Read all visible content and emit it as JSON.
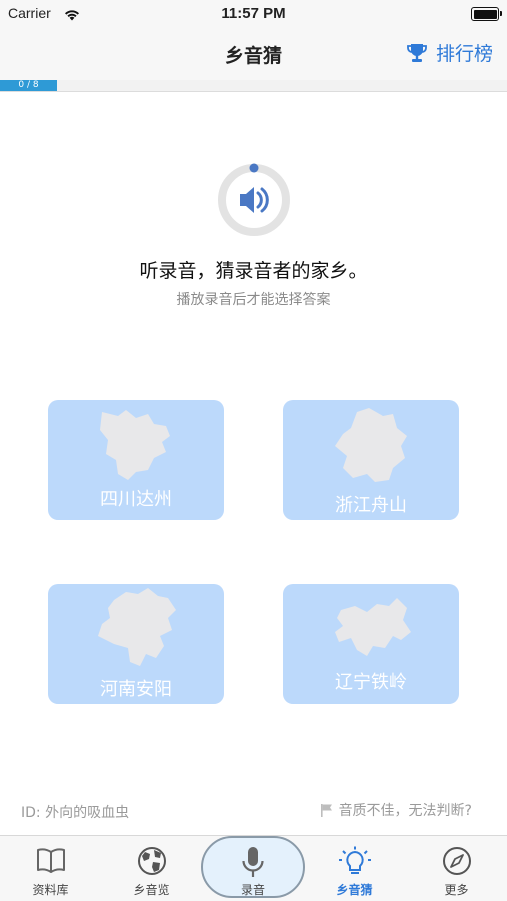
{
  "status": {
    "carrier": "Carrier",
    "time": "11:57 PM"
  },
  "nav": {
    "title": "乡音猜",
    "rank_label": "排行榜"
  },
  "progress": {
    "label": "0 / 8",
    "current": 0,
    "total": 8
  },
  "prompt": "听录音，猜录音者的家乡。",
  "hint": "播放录音后才能选择答案",
  "options": [
    {
      "label": "四川达州"
    },
    {
      "label": "浙江舟山"
    },
    {
      "label": "河南安阳"
    },
    {
      "label": "辽宁铁岭"
    }
  ],
  "footer": {
    "user_id": "ID: 外向的吸血虫",
    "report": "音质不佳，无法判断?"
  },
  "tabs": [
    {
      "label": "资料库",
      "icon": "book-icon"
    },
    {
      "label": "乡音览",
      "icon": "globe-icon"
    },
    {
      "label": "录音",
      "icon": "microphone-icon"
    },
    {
      "label": "乡音猜",
      "icon": "lightbulb-icon",
      "active": true
    },
    {
      "label": "更多",
      "icon": "compass-icon"
    }
  ],
  "colors": {
    "accent": "#2f7ad8",
    "card": "#bcd9fb",
    "progress": "#2e9ad6"
  }
}
